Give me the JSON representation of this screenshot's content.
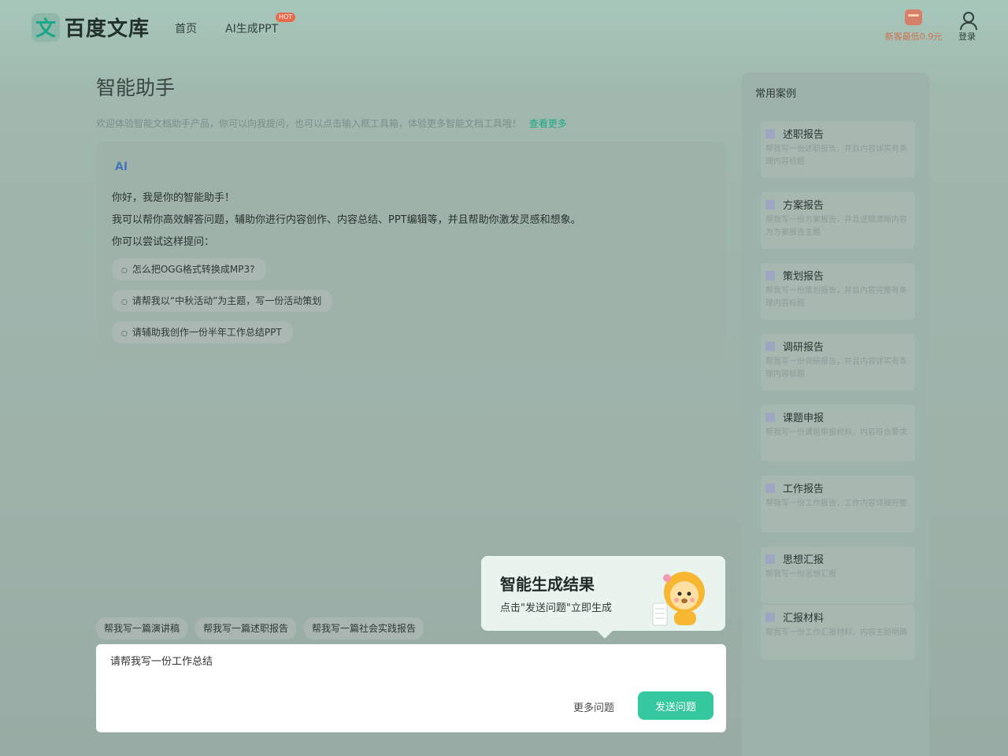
{
  "header": {
    "logo_text": "百度文库",
    "logo_mark": "文",
    "nav": [
      {
        "label": "首页"
      },
      {
        "label": "AI生成PPT",
        "badge": "HOT"
      }
    ],
    "promo_text": "新客最低0.9元",
    "login_label": "登录"
  },
  "main": {
    "title": "智能助手",
    "welcome_text": "欢迎体验智能文档助手产品，你可以向我提问，也可以点击输入框工具箱，体验更多智能文档工具哦！",
    "welcome_link": "查看更多",
    "chat": {
      "ai_icon": "AI",
      "greeting": "你好，我是你的智能助手！",
      "intro": "我可以帮你高效解答问题，辅助你进行内容创作、内容总结、PPT编辑等，并且帮助你激发灵感和想象。",
      "try_prompt": "你可以尝试这样提问：",
      "suggestions": [
        "怎么把OGG格式转换成MP3?",
        "请帮我以“中秋活动”为主题，写一份活动策划",
        "请辅助我创作一份半年工作总结PPT"
      ]
    },
    "quick_tags": [
      "帮我写一篇演讲稿",
      "帮我写一篇述职报告",
      "帮我写一篇社会实践报告"
    ],
    "popup": {
      "title": "智能生成结果",
      "subtitle": "点击\"发送问题\"立即生成"
    },
    "input": {
      "value": "请帮我写一份工作总结",
      "more_label": "更多问题",
      "send_label": "发送问题"
    }
  },
  "sidebar": {
    "title": "常用案例",
    "items": [
      {
        "title": "述职报告",
        "desc": "帮我写一份述职报告，并且内容详实有条理内容标题"
      },
      {
        "title": "方案报告",
        "desc": "帮我写一份方案报告，并且逻辑清晰内容为方案报告主题"
      },
      {
        "title": "策划报告",
        "desc": "帮我写一份策划报告，并且内容完整有条理内容标题"
      },
      {
        "title": "调研报告",
        "desc": "帮我写一份调研报告，并且内容详实有条理内容标题"
      },
      {
        "title": "课题申报",
        "desc": "帮我写一份课题申报材料，内容符合要求"
      },
      {
        "title": "工作报告",
        "desc": "帮我写一份工作报告，工作内容详细完整"
      },
      {
        "title": "思想汇报",
        "desc": "帮我写一份思想汇报"
      },
      {
        "title": "汇报材料",
        "desc": "帮我写一份工作汇报材料，内容主题明确"
      }
    ]
  }
}
